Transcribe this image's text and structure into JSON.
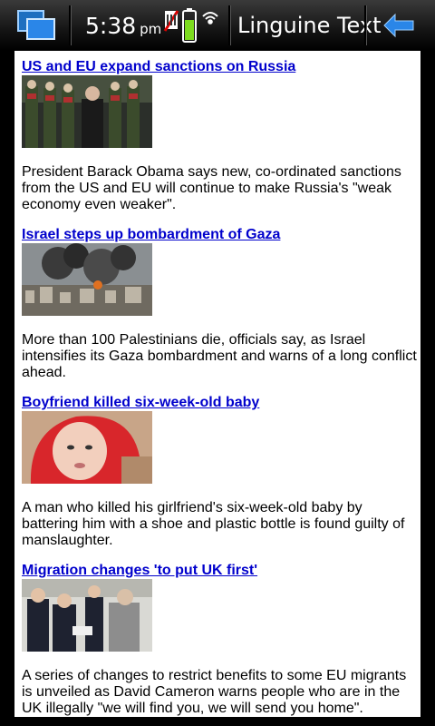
{
  "status_bar": {
    "time": "5:38",
    "ampm": "pm",
    "app_title": "Linguine Text",
    "icons": [
      "task-switcher-icon",
      "mobile-data-icon",
      "battery-icon",
      "wifi-icon",
      "back-arrow-icon"
    ],
    "accent": "#2a86e8",
    "battery_color": "#7ddc1f"
  },
  "articles": [
    {
      "headline": "US and EU expand sanctions on Russia",
      "image": "Putin walking past honour guard",
      "summary": "President Barack Obama says new, co-ordinated sanctions from the US and EU will continue to make Russia's \"weak economy even weaker\"."
    },
    {
      "headline": "Israel steps up bombardment of Gaza",
      "image": "smoke rising over Gaza buildings",
      "summary": "More than 100 Palestinians die, officials say, as Israel intensifies its Gaza bombardment and warns of a long conflict ahead."
    },
    {
      "headline": "Boyfriend killed six-week-old baby",
      "image": "baby in red hooded top",
      "summary": "A man who killed his girlfriend's six-week-old baby by battering him with a shoe and plastic bottle is found guilty of manslaughter."
    },
    {
      "headline": "Migration changes 'to put UK first'",
      "image": "David Cameron with immigration officers",
      "summary": "A series of changes to restrict benefits to some EU migrants is unveiled as David Cameron warns people who are in the UK illegally \"we will find you, we will send you home\"."
    }
  ],
  "link_color": "#0000cc"
}
